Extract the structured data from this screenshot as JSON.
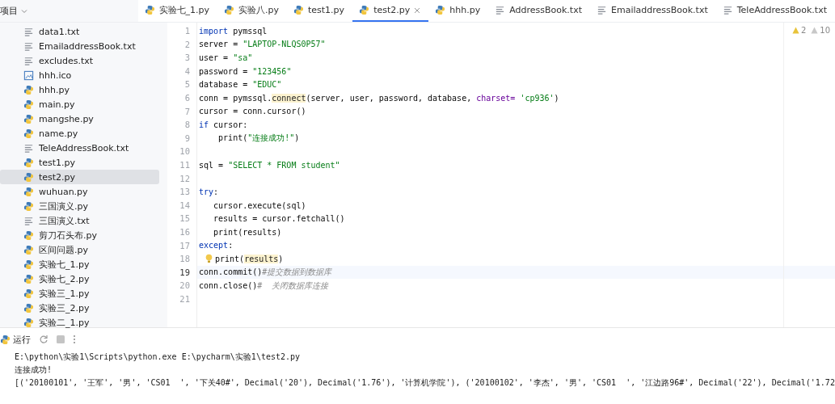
{
  "project_header": {
    "label": "项目"
  },
  "tabs": [
    {
      "label": "实验七_1.py",
      "kind": "py",
      "selected": false
    },
    {
      "label": "实验八.py",
      "kind": "py",
      "selected": false
    },
    {
      "label": "test1.py",
      "kind": "py",
      "selected": false
    },
    {
      "label": "test2.py",
      "kind": "py",
      "selected": true
    },
    {
      "label": "hhh.py",
      "kind": "py",
      "selected": false
    },
    {
      "label": "AddressBook.txt",
      "kind": "txt",
      "selected": false
    },
    {
      "label": "EmailaddressBook.txt",
      "kind": "txt",
      "selected": false
    },
    {
      "label": "TeleAddressBook.txt",
      "kind": "txt",
      "selected": false
    }
  ],
  "sidebar": {
    "items": [
      {
        "label": "data1.txt",
        "kind": "txt",
        "selected": false
      },
      {
        "label": "EmailaddressBook.txt",
        "kind": "txt",
        "selected": false
      },
      {
        "label": "excludes.txt",
        "kind": "txt",
        "selected": false
      },
      {
        "label": "hhh.ico",
        "kind": "ico",
        "selected": false
      },
      {
        "label": "hhh.py",
        "kind": "py",
        "selected": false
      },
      {
        "label": "main.py",
        "kind": "py",
        "selected": false
      },
      {
        "label": "mangshe.py",
        "kind": "py",
        "selected": false
      },
      {
        "label": "name.py",
        "kind": "py",
        "selected": false
      },
      {
        "label": "TeleAddressBook.txt",
        "kind": "txt",
        "selected": false
      },
      {
        "label": "test1.py",
        "kind": "py",
        "selected": false
      },
      {
        "label": "test2.py",
        "kind": "py",
        "selected": true
      },
      {
        "label": "wuhuan.py",
        "kind": "py",
        "selected": false
      },
      {
        "label": "三国演义.py",
        "kind": "py",
        "selected": false
      },
      {
        "label": "三国演义.txt",
        "kind": "txt",
        "selected": false
      },
      {
        "label": "剪刀石头布.py",
        "kind": "py",
        "selected": false
      },
      {
        "label": "区间问题.py",
        "kind": "py",
        "selected": false
      },
      {
        "label": "实验七_1.py",
        "kind": "py",
        "selected": false
      },
      {
        "label": "实验七_2.py",
        "kind": "py",
        "selected": false
      },
      {
        "label": "实验三_1.py",
        "kind": "py",
        "selected": false
      },
      {
        "label": "实验三_2.py",
        "kind": "py",
        "selected": false
      },
      {
        "label": "实验二_1.py",
        "kind": "py",
        "selected": false
      }
    ]
  },
  "inspections": {
    "warnings": "2",
    "weak_warnings": "10"
  },
  "editor": {
    "lines": [
      {
        "number": "1",
        "current": false,
        "tokens": [
          {
            "kind": "keyword",
            "text": "import"
          },
          {
            "kind": "plain",
            "text": " pymssql"
          }
        ]
      },
      {
        "number": "2",
        "current": false,
        "tokens": [
          {
            "kind": "plain",
            "text": "server = "
          },
          {
            "kind": "string",
            "text": "\"LAPTOP-NLQS0P57\""
          }
        ]
      },
      {
        "number": "3",
        "current": false,
        "tokens": [
          {
            "kind": "plain",
            "text": "user = "
          },
          {
            "kind": "string",
            "text": "\"sa\""
          }
        ]
      },
      {
        "number": "4",
        "current": false,
        "tokens": [
          {
            "kind": "plain",
            "text": "password = "
          },
          {
            "kind": "string",
            "text": "\"123456\""
          }
        ]
      },
      {
        "number": "5",
        "current": false,
        "tokens": [
          {
            "kind": "plain",
            "text": "database = "
          },
          {
            "kind": "string",
            "text": "\"EDUC\""
          }
        ]
      },
      {
        "number": "6",
        "current": false,
        "tokens": [
          {
            "kind": "plain",
            "text": "conn = pymssql."
          },
          {
            "kind": "func",
            "text": "connect"
          },
          {
            "kind": "plain",
            "text": "(server, user, password, database, "
          },
          {
            "kind": "param",
            "text": "charset="
          },
          {
            "kind": "string",
            "text": " 'cp936'"
          },
          {
            "kind": "plain",
            "text": ")"
          }
        ]
      },
      {
        "number": "7",
        "current": false,
        "tokens": [
          {
            "kind": "plain",
            "text": "cursor = conn.cursor()"
          }
        ]
      },
      {
        "number": "8",
        "current": false,
        "tokens": [
          {
            "kind": "keyword",
            "text": "if"
          },
          {
            "kind": "plain",
            "text": " cursor:"
          }
        ]
      },
      {
        "number": "9",
        "current": false,
        "tokens": [
          {
            "kind": "plain",
            "text": "    print("
          },
          {
            "kind": "string",
            "text": "\"连接成功!\""
          },
          {
            "kind": "plain",
            "text": ")"
          }
        ]
      },
      {
        "number": "10",
        "current": false
      },
      {
        "number": "11",
        "current": false,
        "tokens": [
          {
            "kind": "plain",
            "text": "sql = "
          },
          {
            "kind": "string",
            "text": "\"SELECT * FROM student\""
          }
        ]
      },
      {
        "number": "12",
        "current": false
      },
      {
        "number": "13",
        "current": false,
        "tokens": [
          {
            "kind": "keyword",
            "text": "try"
          },
          {
            "kind": "plain",
            "text": ":"
          }
        ]
      },
      {
        "number": "14",
        "current": false,
        "tokens": [
          {
            "kind": "plain",
            "text": "   cursor.execute(sql)"
          }
        ]
      },
      {
        "number": "15",
        "current": false,
        "tokens": [
          {
            "kind": "plain",
            "text": "   results = cursor.fetchall()"
          }
        ]
      },
      {
        "number": "16",
        "current": false,
        "tokens": [
          {
            "kind": "plain",
            "text": "   print(results)"
          }
        ]
      },
      {
        "number": "17",
        "current": false,
        "tokens": [
          {
            "kind": "keyword",
            "text": "except"
          },
          {
            "kind": "plain",
            "text": ":"
          }
        ]
      },
      {
        "number": "18",
        "current": false,
        "bulb": true,
        "tokens": [
          {
            "kind": "plain",
            "text": "print("
          },
          {
            "kind": "func",
            "text": "results"
          },
          {
            "kind": "plain",
            "text": ")"
          }
        ]
      },
      {
        "number": "19",
        "current": true,
        "tokens": [
          {
            "kind": "plain",
            "text": "conn.commit()"
          },
          {
            "kind": "comment",
            "text": "#提交数据到数据库"
          }
        ]
      },
      {
        "number": "20",
        "current": false,
        "tokens": [
          {
            "kind": "plain",
            "text": "conn.close()"
          },
          {
            "kind": "comment",
            "text": "#  关闭数据库连接"
          }
        ]
      },
      {
        "number": "21",
        "current": false
      }
    ]
  },
  "run_panel": {
    "title": "运行",
    "output": [
      "E:\\python\\实验1\\Scripts\\python.exe E:\\pycharm\\实验1\\test2.py",
      "连接成功!",
      "[('20100101', '王军', '男', 'CS01  ', '下关40#', Decimal('20'), Decimal('1.76'), '计算机学院'), ('20100102', '李杰', '男', 'CS01  ', '江边路96#', Decimal('22'), Decimal('1.72"
    ]
  }
}
